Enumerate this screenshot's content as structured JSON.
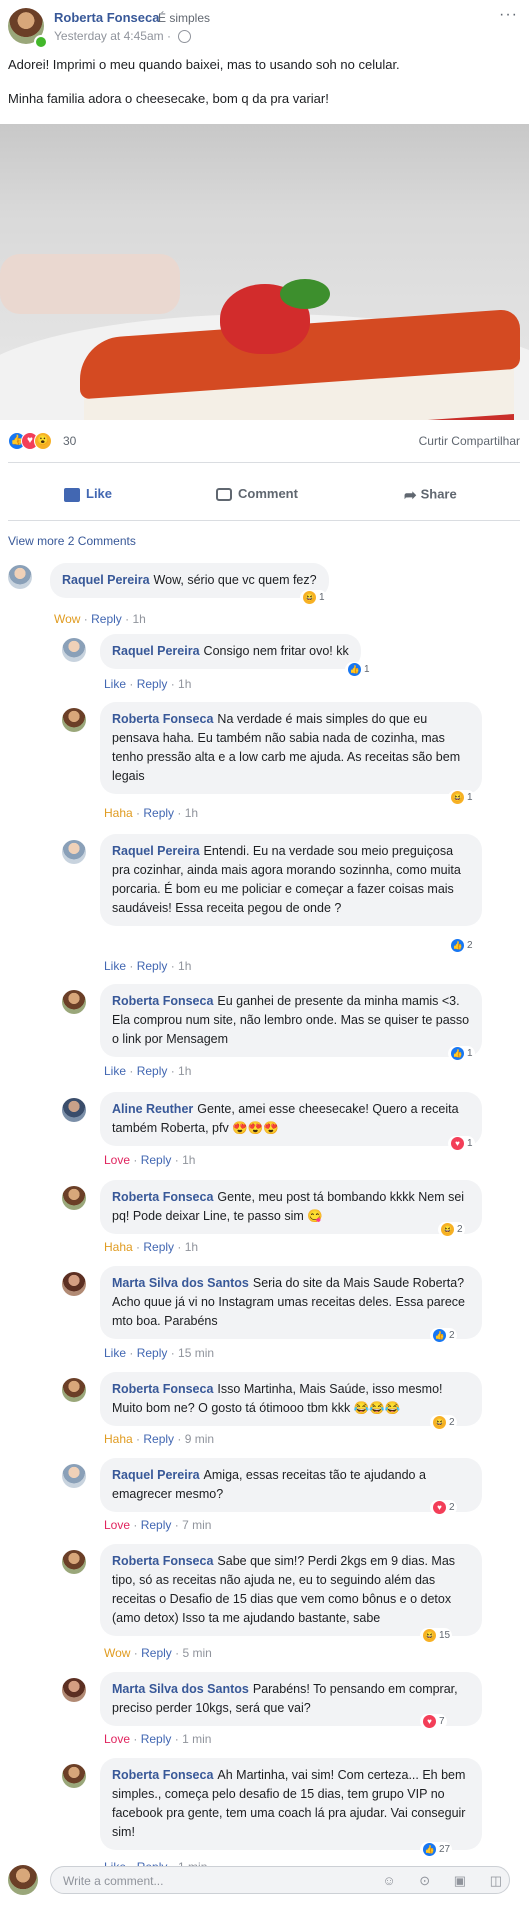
{
  "post": {
    "author": "Roberta Fonseca",
    "group": "É simples",
    "time": "Yesterday at 4:45am",
    "more": "···",
    "text": "Adorei! Imprimi o meu quando baixei, mas to usando soh no celular.\n\nMinha familia adora o cheesecake, bom q da pra variar!",
    "reaction_count": "30",
    "right_actions": "Curtir Compartilhar",
    "like_label": "Like",
    "comment_label": "Comment",
    "share_label": "Share"
  },
  "view_more": "View more 2 Comments",
  "write": {
    "placeholder": "Write a comment...",
    "icons": "☺ ⊙ ▣ ◫"
  },
  "comments": [
    {
      "name": "Raquel Pereira",
      "text": "Wow, sério que vc quem fez?",
      "reaction_label": "Wow",
      "time": "1h",
      "badge": "1"
    },
    {
      "name": "Raquel Pereira",
      "text": "Consigo nem fritar ovo! kk",
      "reaction_label": "Like",
      "time": "1h",
      "badge": "1"
    },
    {
      "name": "Roberta Fonseca",
      "text": "Na verdade é mais simples do que eu pensava haha. Eu também não sabia nada de cozinha, mas tenho pressão alta e a low carb me ajuda. As receitas são bem legais",
      "reaction_label": "Haha",
      "time": "1h",
      "badge": "1"
    },
    {
      "name": "Raquel Pereira",
      "text": "Entendi. Eu na verdade sou meio preguiçosa pra cozinhar, ainda mais agora morando sozinnha, como muita porcaria. É bom eu me policiar e começar a fazer coisas mais saudáveis! Essa receita pegou de onde ?",
      "reaction_label": "Like",
      "time": "1h",
      "badge": "2"
    },
    {
      "name": "Roberta Fonseca",
      "text": "Eu ganhei de presente da minha mamis <3. Ela comprou num site, não lembro onde. Mas se quiser te passo o link por Mensagem",
      "reaction_label": "Like",
      "time": "1h",
      "badge": "1"
    },
    {
      "name": "Aline Reuther",
      "text": "Gente, amei esse cheesecake! Quero a receita também Roberta, pfv 😍😍😍",
      "reaction_label": "Love",
      "time": "1h",
      "badge": "1"
    },
    {
      "name": "Roberta Fonseca",
      "text": "Gente, meu post tá bombando kkkk Nem sei pq! Pode deixar Line, te passo sim 😋",
      "reaction_label": "Haha",
      "time": "1h",
      "badge": "2"
    },
    {
      "name": "Marta Silva dos Santos",
      "text": "Seria do site da Mais Saude Roberta? Acho quue já vi no Instagram umas receitas deles. Essa parece mto boa. Parabéns",
      "reaction_label": "Like",
      "time": "15 min",
      "badge": "2"
    },
    {
      "name": "Roberta Fonseca",
      "text": "Isso Martinha, Mais Saúde, isso mesmo! Muito bom ne? O gosto tá ótimooo tbm kkk 😂😂😂",
      "reaction_label": "Haha",
      "time": "9 min",
      "badge": "2"
    },
    {
      "name": "Raquel Pereira",
      "text": "Amiga, essas receitas tão te ajudando a emagrecer mesmo?",
      "reaction_label": "Love",
      "time": "7 min",
      "badge": "2"
    },
    {
      "name": "Roberta Fonseca",
      "text": "Sabe que sim!? Perdi 2kgs em 9 dias. Mas tipo, só as receitas não ajuda ne, eu to seguindo além das receitas o Desafio de 15 dias que vem como bônus e o detox (amo detox) Isso ta me ajudando bastante, sabe",
      "reaction_label": "Wow",
      "time": "5 min",
      "badge": "15"
    },
    {
      "name": "Marta Silva dos Santos",
      "text": "Parabéns! To pensando em comprar, preciso perder 10kgs, será que vai?",
      "reaction_label": "Love",
      "time": "1 min",
      "badge": "7"
    },
    {
      "name": "Roberta Fonseca",
      "text": "Ah Martinha, vai sim! Com certeza... Eh bem simples., começa pelo desafio de 15 dias, tem grupo VIP no facebook pra gente, tem uma coach lá pra ajudar. Vai conseguir sim!",
      "reaction_label": "Like",
      "time": "1 min",
      "badge": "27"
    }
  ],
  "reply_label": "Reply",
  "colors": {
    "link": "#385898",
    "like": "#1877f2",
    "love": "#f33e58",
    "haha": "#f7b125",
    "bubble": "#f2f3f5"
  }
}
